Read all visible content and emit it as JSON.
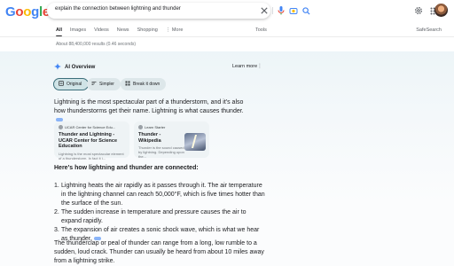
{
  "logo": {
    "letters": [
      "G",
      "o",
      "o",
      "g",
      "l",
      "e"
    ],
    "colors": [
      "#4285f4",
      "#ea4335",
      "#fbbc05",
      "#4285f4",
      "#34a853",
      "#ea4335"
    ]
  },
  "search": {
    "query": "explain the connection between lightning and thunder"
  },
  "tabs": [
    "All",
    "Images",
    "Videos",
    "News",
    "Shopping",
    "⋮ More"
  ],
  "tools_label": "Tools",
  "safesearch_label": "SafeSearch",
  "results_count": "About 88,400,000 results (0.46 seconds)",
  "ai_overview": {
    "title": "AI Overview",
    "learn_more": "Learn more",
    "chips": [
      "Original",
      "Simpler",
      "Break it down"
    ],
    "summary": "Lightning is the most spectacular part of a thunderstorm, and it's also how thunderstorms get their name. Lightning is what causes thunder.",
    "cards": [
      {
        "source": "UCAR Center for Science Edu...",
        "title": "Thunder and Lightning - UCAR Center for Science Education",
        "snippet": "Lightning is the most spectacular element of a thunderstorm. In fact it i..."
      },
      {
        "source": "Learn Starter",
        "title": "Thunder - Wikipedia",
        "snippet": "Thunder is the sound caused by lightning. Depending upon the..."
      }
    ],
    "subheading": "Here's how lightning and thunder are connected:",
    "steps": [
      "Lightning heats the air rapidly as it passes through it. The air temperature in the lightning channel can reach 50,000°F, which is five times hotter than the surface of the sun.",
      "The sudden increase in temperature and pressure causes the air to expand rapidly.",
      "The expansion of air creates a sonic shock wave, which is what we hear as thunder."
    ],
    "closing": "The thunderclap or peal of thunder can range from a long, low rumble to a sudden, loud crack. Thunder can usually be heard from about 10 miles away from a lightning strike."
  }
}
